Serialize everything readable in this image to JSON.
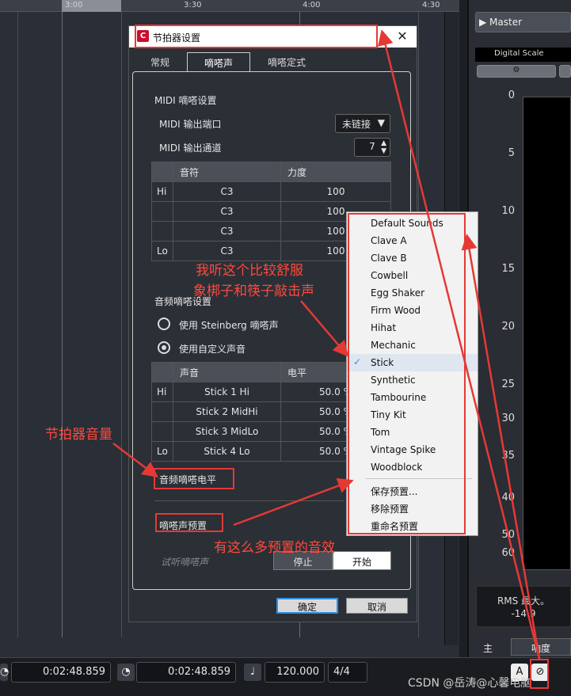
{
  "timeline": {
    "marks": [
      "3:00",
      "3:30",
      "4:00",
      "4:30"
    ]
  },
  "mixer": {
    "master_label": "▶ Master",
    "digital_scale": "Digital Scale",
    "gear_icon": "⚙",
    "scale": [
      "0",
      "5",
      "10",
      "15",
      "20",
      "25",
      "30",
      "35",
      "40",
      "50",
      "60"
    ],
    "rms_line1": "RMS 最大。",
    "rms_line2": "-14.9",
    "tab_main": "主",
    "tab_loudness": "响度"
  },
  "transport": {
    "time1": "0:02:48.859",
    "time2": "0:02:48.859",
    "tempo": "120.000",
    "signature": "4/4",
    "watermark": "CSDN @岳涛@心馨电脑"
  },
  "dialog": {
    "title": "节拍器设置",
    "icon_letter": "C",
    "close": "✕",
    "tabs": [
      "常规",
      "嘀嗒声",
      "嘀嗒定式"
    ],
    "midi": {
      "section": "MIDI 嘀嗒设置",
      "port_label": "MIDI 输出端口",
      "port_value": "未链接",
      "channel_label": "MIDI 输出通道",
      "channel_value": "7",
      "headers": [
        "",
        "音符",
        "力度"
      ],
      "rows": [
        [
          "Hi",
          "C3",
          "100"
        ],
        [
          "",
          "C3",
          "100"
        ],
        [
          "",
          "C3",
          "100"
        ],
        [
          "Lo",
          "C3",
          "100"
        ]
      ]
    },
    "audio": {
      "section": "音频嘀嗒设置",
      "radio1": "使用 Steinberg 嘀嗒声",
      "radio2": "使用自定义声音",
      "headers": [
        "",
        "声音",
        "电平"
      ],
      "rows": [
        [
          "Hi",
          "Stick 1 Hi",
          "50.0 %"
        ],
        [
          "",
          "Stick 2 MidHi",
          "50.0 %"
        ],
        [
          "",
          "Stick 3 MidLo",
          "50.0 %"
        ],
        [
          "Lo",
          "Stick 4 Lo",
          "50.0 %"
        ]
      ],
      "level_label": "音频嘀嗒电平",
      "preset_label": "嘀嗒声预置"
    },
    "preview_label": "试听嘀嗒声",
    "stop": "停止",
    "start": "开始",
    "ok": "确定",
    "cancel": "取消"
  },
  "menu": {
    "items": [
      "Default Sounds",
      "Clave A",
      "Clave B",
      "Cowbell",
      "Egg Shaker",
      "Firm Wood",
      "Hihat",
      "Mechanic",
      "Stick",
      "Synthetic",
      "Tambourine",
      "Tiny Kit",
      "Tom",
      "Vintage Spike",
      "Woodblock"
    ],
    "checked": "Stick",
    "check_mark": "✓",
    "actions": [
      "保存预置...",
      "移除预置",
      "重命名预置"
    ]
  },
  "annotations": {
    "a1": "我听这个比较舒服",
    "a2": "象梆子和筷子敲击声",
    "a3": "节拍器音量",
    "a4": "有这么多预置的音效"
  },
  "colors": {
    "accent_red": "#e53935",
    "annotation_red": "#ff4a3d",
    "check_blue": "#3b82f6"
  }
}
